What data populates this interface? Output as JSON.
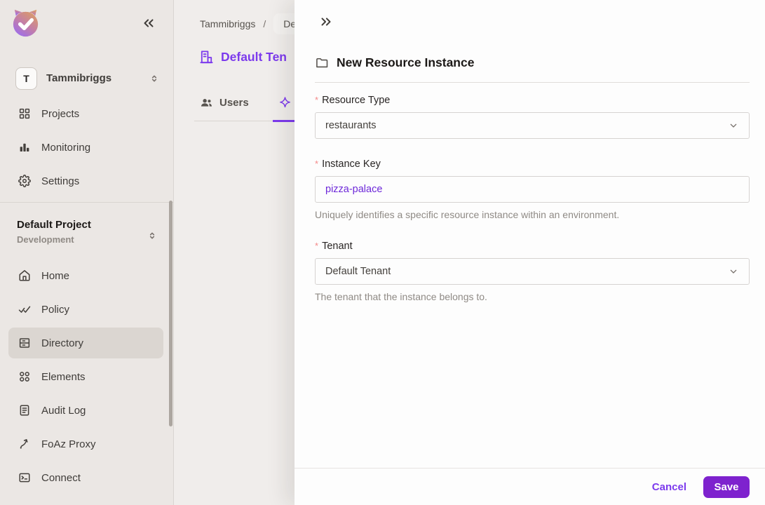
{
  "colors": {
    "accent_purple": "#7C3AED",
    "save_button_bg": "#7E22CE",
    "sidebar_bg": "#EBE7E4",
    "active_nav_bg": "#DBD6D1",
    "required_asterisk": "#F48989",
    "instance_key_text": "#6D28D9"
  },
  "sidebar": {
    "user": {
      "initial": "T",
      "name": "Tammibriggs"
    },
    "nav_top": [
      {
        "label": "Projects",
        "icon": "grid-icon"
      },
      {
        "label": "Monitoring",
        "icon": "bar-chart-icon"
      },
      {
        "label": "Settings",
        "icon": "gear-icon"
      }
    ],
    "project_switcher": {
      "project": "Default Project",
      "environment": "Development"
    },
    "nav_main": [
      {
        "label": "Home",
        "icon": "home-icon"
      },
      {
        "label": "Policy",
        "icon": "double-check-icon"
      },
      {
        "label": "Directory",
        "icon": "cabinet-icon",
        "active": true
      },
      {
        "label": "Elements",
        "icon": "circles-grid-icon"
      },
      {
        "label": "Audit Log",
        "icon": "document-icon"
      },
      {
        "label": "FoAz Proxy",
        "icon": "curved-arrow-icon"
      },
      {
        "label": "Connect",
        "icon": "terminal-icon"
      }
    ]
  },
  "main": {
    "breadcrumb": {
      "root": "Tammibriggs",
      "separator": "/",
      "current_truncated": "De"
    },
    "page_title_truncated": "Default Ten",
    "tabs": [
      {
        "label": "Users",
        "icon": "users-icon"
      },
      {
        "icon": "sparkle-icon",
        "active": true
      }
    ]
  },
  "panel": {
    "title": "New Resource Instance",
    "required_marker": "*",
    "fields": {
      "resource_type": {
        "label": "Resource Type",
        "value": "restaurants",
        "required": true
      },
      "instance_key": {
        "label": "Instance Key",
        "value": "pizza-palace",
        "required": true,
        "helper": "Uniquely identifies a specific resource instance within an environment."
      },
      "tenant": {
        "label": "Tenant",
        "value": "Default Tenant",
        "required": true,
        "helper": "The tenant that the instance belongs to."
      }
    },
    "footer": {
      "cancel_label": "Cancel",
      "save_label": "Save"
    }
  }
}
